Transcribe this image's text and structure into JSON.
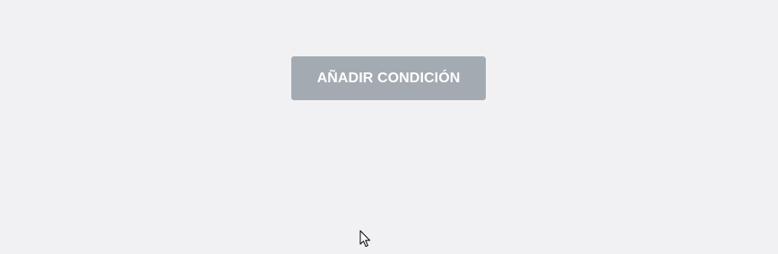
{
  "add_condition_button": {
    "label": "AÑADIR CONDICIÓN"
  },
  "colors": {
    "background": "#f1f1f3",
    "button_background": "#a4aab1",
    "button_text": "#ffffff"
  },
  "icons": {
    "pointer": "mouse-pointer-icon"
  }
}
